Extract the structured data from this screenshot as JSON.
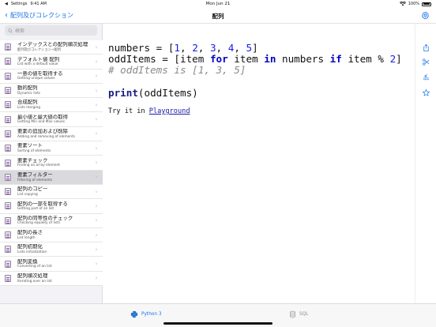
{
  "statusbar": {
    "app": "Settings",
    "time": "9:41 AM",
    "date": "Mon Jun 21",
    "battery": "100%"
  },
  "navbar": {
    "back_label": "配列及びコレクション",
    "title": "配列"
  },
  "sidebar": {
    "search_placeholder": "検索",
    "items": [
      {
        "title": "インデックスとの配列順次処理",
        "subtitle": "配列及びコレクション→配列"
      },
      {
        "title": "デフォルト値 配列",
        "subtitle": "List with a default value"
      },
      {
        "title": "一意の値を取得する",
        "subtitle": "Getting unique values"
      },
      {
        "title": "動的配列",
        "subtitle": "Dynamic lists"
      },
      {
        "title": "合成配列",
        "subtitle": "Lists merging"
      },
      {
        "title": "最小値と最大値の取得",
        "subtitle": "Getting Min and Max values"
      },
      {
        "title": "要素の追加および削除",
        "subtitle": "Adding and removing of elements"
      },
      {
        "title": "要素ソート",
        "subtitle": "Sorting of elements"
      },
      {
        "title": "要素チェック",
        "subtitle": "Finding an array element"
      },
      {
        "title": "要素フィルター",
        "subtitle": "Filtering of elements",
        "active": true
      },
      {
        "title": "配列のコピー",
        "subtitle": "List copying"
      },
      {
        "title": "配列の一部を取得する",
        "subtitle": "Getting part of an list"
      },
      {
        "title": "配列の同等性のチェック",
        "subtitle": "Checking equality of lists"
      },
      {
        "title": "配列の長さ",
        "subtitle": "List length"
      },
      {
        "title": "配列初期化",
        "subtitle": "Lists initialization"
      },
      {
        "title": "配列変換",
        "subtitle": "Converting of an list"
      },
      {
        "title": "配列順次処理",
        "subtitle": "Iterating over an list"
      }
    ]
  },
  "content": {
    "code": {
      "line1": {
        "var": "numbers",
        "op": " = ",
        "open": "[",
        "n1": "1",
        "n2": "2",
        "n3": "3",
        "n4": "4",
        "n5": "5",
        "close": "]"
      },
      "line2": {
        "var": "oddItems",
        "op": " = ",
        "open": "[",
        "item1": "item",
        "kw_for": "for",
        "item2": "item",
        "kw_in": "in",
        "src": "numbers",
        "kw_if": "if",
        "item3": "item",
        "mod": "%",
        "two": "2",
        "close": "]"
      },
      "line3": "# oddItems is [1, 3, 5]",
      "line5": {
        "func": "print",
        "arg": "(oddItems)"
      }
    },
    "try_prefix": "Try it in ",
    "try_link": "Playground"
  },
  "rightbar": {
    "icons": [
      "share-icon",
      "scissors-icon",
      "collapse-icon",
      "star-icon"
    ]
  },
  "tabbar": {
    "tabs": [
      {
        "label": "Python 3",
        "icon": "python-icon",
        "selected": true
      },
      {
        "label": "SQL",
        "icon": "database-icon",
        "selected": false
      }
    ]
  },
  "colors": {
    "accent": "#1a73e8",
    "keyword": "#0000c8",
    "comment": "#8a8a8a",
    "sidebar_bg": "#f2f2f7",
    "selected_row": "#d9d9de"
  }
}
